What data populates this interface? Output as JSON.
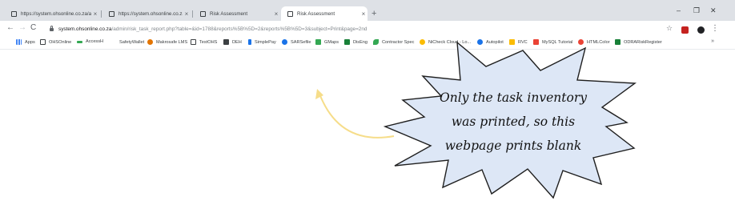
{
  "tabs": [
    {
      "title": "https://system.ohsonline.co.za/a…",
      "active": false
    },
    {
      "title": "https://system.ohsonline.co.za/a…",
      "active": false
    },
    {
      "title": "Risk Assessment",
      "active": false
    },
    {
      "title": "Risk Assessment",
      "active": true
    }
  ],
  "url": {
    "host": "system.ohsonline.co.za",
    "path": "/admin/risk_task_report.php?table=&id=1788&reports%5B%5D=2&reports%5B%5D=3&subject=Print&page=2nd"
  },
  "bookmarks": [
    {
      "label": "Apps",
      "color": "#4285f4"
    },
    {
      "label": "OHSOnline",
      "color": "#3c4043"
    },
    {
      "label": "AccessH",
      "color": "#34a853"
    },
    {
      "label": "SafetyWallet",
      "color": "#ffffff"
    },
    {
      "label": "Makrosafe LMS",
      "color": "#e37400"
    },
    {
      "label": "TestOHS",
      "color": "#3c4043"
    },
    {
      "label": "DEH",
      "color": "#3c4043"
    },
    {
      "label": "SimplePay",
      "color": "#1a73e8"
    },
    {
      "label": "SARSefile",
      "color": "#1a73e8"
    },
    {
      "label": "GMaps",
      "color": "#34a853"
    },
    {
      "label": "DisEng",
      "color": "#188038"
    },
    {
      "label": "Contractor Spec",
      "color": "#34a853"
    },
    {
      "label": "NiCheck Cloud - Lo...",
      "color": "#fbbc04"
    },
    {
      "label": "Autopilot",
      "color": "#1a73e8"
    },
    {
      "label": "RVC",
      "color": "#fbbc04"
    },
    {
      "label": "MySQL Tutorial",
      "color": "#ea4335"
    },
    {
      "label": "HTMLColor",
      "color": "#ea4335"
    },
    {
      "label": "ODRARiskRegister",
      "color": "#188038"
    }
  ],
  "bookmarks_more": "»",
  "new_tab": "+",
  "window_controls": {
    "minimize": "–",
    "maximize": "❐",
    "close": "✕"
  },
  "nav": {
    "back": "←",
    "forward": "→",
    "reload": "C"
  },
  "toolbar_icons": {
    "star": "☆",
    "menu": "⋮"
  },
  "callout": {
    "lines": [
      "Only the task inventory",
      "was printed, so this",
      "webpage prints blank"
    ]
  },
  "colors": {
    "callout_fill": "#dde7f6",
    "callout_stroke": "#1f1f1f",
    "arrow": "#f6dd8a"
  }
}
